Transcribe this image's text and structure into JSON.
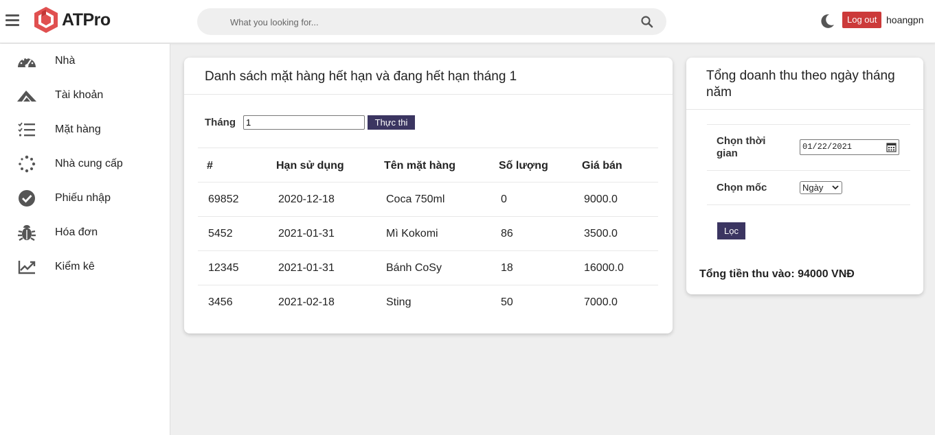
{
  "app": {
    "name": "ATPro"
  },
  "header": {
    "search_placeholder": "What you looking for...",
    "logout_label": "Log out",
    "username": "hoangpn"
  },
  "sidebar": {
    "items": [
      {
        "label": "Nhà",
        "icon": "dashboard-gauge-icon"
      },
      {
        "label": "Tài khoản",
        "icon": "account-icon"
      },
      {
        "label": "Mặt hàng",
        "icon": "checklist-icon"
      },
      {
        "label": "Nhà cung cấp",
        "icon": "spinner-dots-icon"
      },
      {
        "label": "Phiếu nhập",
        "icon": "check-circle-icon"
      },
      {
        "label": "Hóa đơn",
        "icon": "bug-icon"
      },
      {
        "label": "Kiểm kê",
        "icon": "trend-chart-icon"
      }
    ]
  },
  "expiry": {
    "title": "Danh sách mặt hàng hết hạn và đang hết hạn tháng 1",
    "month_label": "Tháng",
    "month_value": "1",
    "run_label": "Thực thi",
    "columns": [
      "#",
      "Hạn sử dụng",
      "Tên mặt hàng",
      "Số lượng",
      "Giá bán"
    ],
    "rows": [
      [
        "69852",
        "2020-12-18",
        "Coca 750ml",
        "0",
        "9000.0"
      ],
      [
        "5452",
        "2021-01-31",
        "Mì Kokomi",
        "86",
        "3500.0"
      ],
      [
        "12345",
        "2021-01-31",
        "Bánh CoSy",
        "18",
        "16000.0"
      ],
      [
        "3456",
        "2021-02-18",
        "Sting",
        "50",
        "7000.0"
      ]
    ]
  },
  "revenue": {
    "title": "Tổng doanh thu theo ngày tháng năm",
    "time_label": "Chọn thời gian",
    "date_value": "01/22/2021",
    "milestone_label": "Chọn mốc",
    "milestone_value": "Ngày",
    "filter_label": "Lọc",
    "total_text": "Tổng tiền thu vào: 94000 VNĐ"
  },
  "colors": {
    "accent": "#3b3561",
    "logout": "#cc3a3a",
    "logo": "#e05050"
  }
}
